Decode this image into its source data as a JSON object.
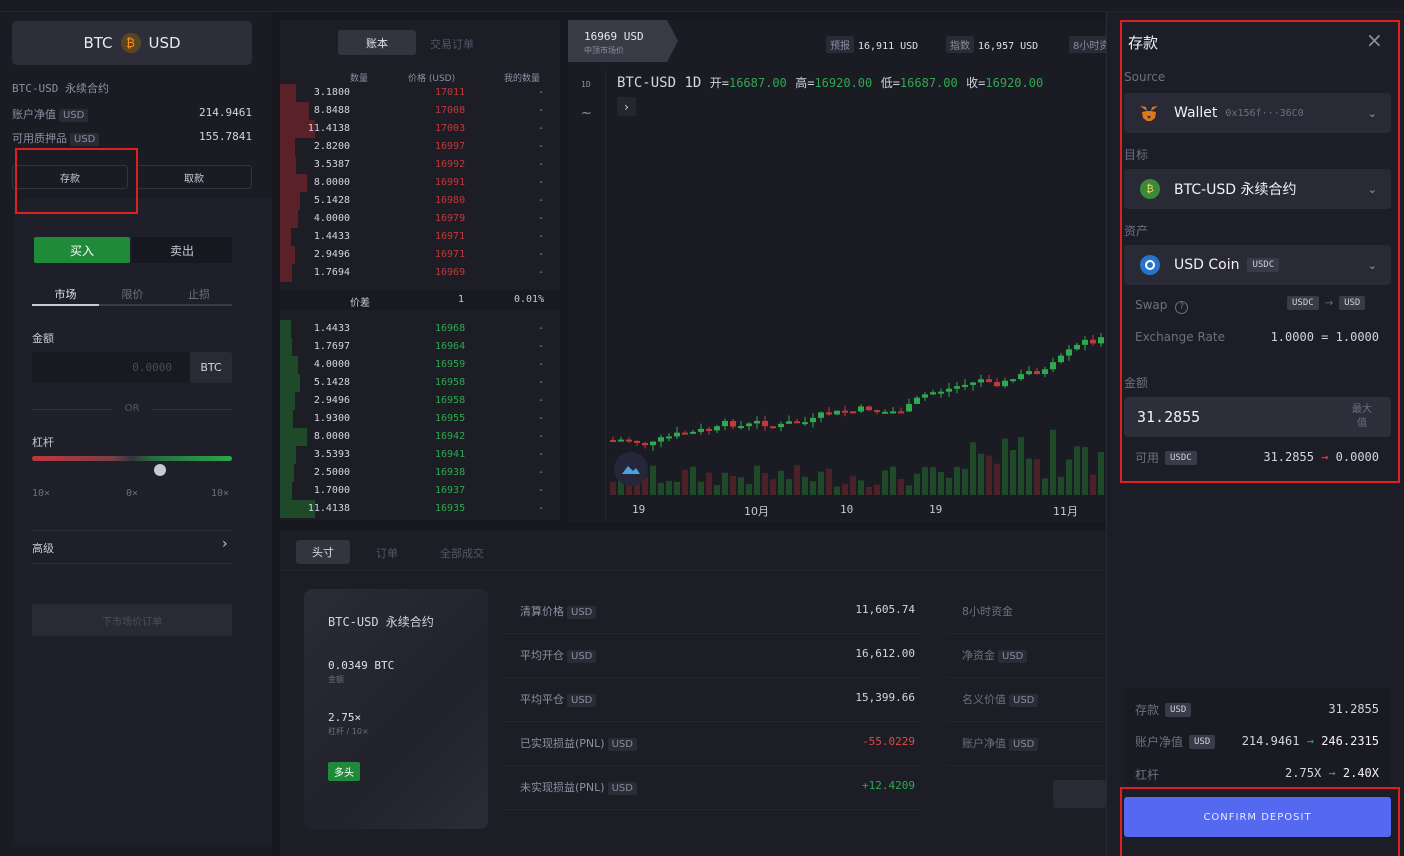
{
  "colors": {
    "accent": "#5468f0",
    "buy": "#1f8a3a",
    "up": "#2fa84f",
    "down": "#c0393b",
    "highlight": "#e02020"
  },
  "left": {
    "pair_base": "BTC",
    "pair_quote": "USD",
    "market_name": "BTC-USD 永续合约",
    "equity_label": "账户净值",
    "equity_unit": "USD",
    "equity_value": "214.9461",
    "collateral_label": "可用质押品",
    "collateral_unit": "USD",
    "collateral_value": "155.7841",
    "deposit_btn": "存款",
    "withdraw_btn": "取款",
    "buy_tab": "买入",
    "sell_tab": "卖出",
    "order_types": [
      "市场",
      "限价",
      "止损"
    ],
    "amount_label": "金额",
    "amount_placeholder": "0.0000",
    "amount_unit": "BTC",
    "or_label": "OR",
    "leverage_label": "杠杆",
    "lev_left": "10×",
    "lev_mid": "0×",
    "lev_right": "10×",
    "leverage_level": 0.64,
    "advanced_label": "高级",
    "advanced_chevron": "›",
    "submit_btn": "下市场价订单"
  },
  "book": {
    "tab_account": "账本",
    "tab_trades": "交易订单",
    "col_size": "数量",
    "col_price": "价格 (USD)",
    "col_mine": "我的数量",
    "asks": [
      [
        "3.1800",
        "17011",
        "-"
      ],
      [
        "8.8488",
        "17008",
        "-"
      ],
      [
        "11.4138",
        "17003",
        "-"
      ],
      [
        "2.8200",
        "16997",
        "-"
      ],
      [
        "3.5387",
        "16992",
        "-"
      ],
      [
        "8.0000",
        "16991",
        "-"
      ],
      [
        "5.1428",
        "16980",
        "-"
      ],
      [
        "4.0000",
        "16979",
        "-"
      ],
      [
        "1.4433",
        "16971",
        "-"
      ],
      [
        "2.9496",
        "16971",
        "-"
      ],
      [
        "1.7694",
        "16969",
        "-"
      ]
    ],
    "spread_label": "价差",
    "spread_value": "1",
    "spread_pct": "0.01%",
    "bids": [
      [
        "1.4433",
        "16968",
        "-"
      ],
      [
        "1.7697",
        "16964",
        "-"
      ],
      [
        "4.0000",
        "16959",
        "-"
      ],
      [
        "5.1428",
        "16958",
        "-"
      ],
      [
        "2.9496",
        "16958",
        "-"
      ],
      [
        "1.9300",
        "16955",
        "-"
      ],
      [
        "8.0000",
        "16942",
        "-"
      ],
      [
        "3.5393",
        "16941",
        "-"
      ],
      [
        "2.5000",
        "16938",
        "-"
      ],
      [
        "1.7000",
        "16937",
        "-"
      ],
      [
        "11.4138",
        "16935",
        "-"
      ]
    ]
  },
  "ticker": {
    "price": "16969 USD",
    "price_sub": "中顶市场价",
    "oracle_label": "预报",
    "oracle_value": "16,911 USD",
    "index_label": "指数",
    "index_value": "16,957 USD",
    "funding_label": "8小时资"
  },
  "chart": {
    "symbol": "BTC-USD",
    "interval": "1D",
    "interval_btn": "1D",
    "tool_icon": "~",
    "expand_icon": "›",
    "open_label": "开=",
    "open": "16687.00",
    "high_label": "高=",
    "high": "16920.00",
    "low_label": "低=",
    "low": "16687.00",
    "close_label": "收=",
    "close": "16920.00",
    "xticks": [
      "19",
      "10月",
      "10",
      "19",
      "11月"
    ]
  },
  "positions": {
    "tabs": [
      "头寸",
      "订单",
      "全部成交"
    ],
    "card_title": "BTC-USD 永续合约",
    "card_size": "0.0349 BTC",
    "card_size_sub": "金额",
    "card_lev": "2.75×",
    "card_lev_sub": "杠杆 / 10×",
    "card_side": "多头",
    "rows": [
      {
        "label": "清算价格",
        "unit": "USD",
        "value": "11,605.74"
      },
      {
        "label": "平均开仓",
        "unit": "USD",
        "value": "16,612.00"
      },
      {
        "label": "平均平仓",
        "unit": "USD",
        "value": "15,399.66"
      },
      {
        "label": "已实现损益(PNL)",
        "unit": "USD",
        "value": "-55.0229"
      },
      {
        "label": "未实现损益(PNL)",
        "unit": "USD",
        "value": "+12.4209"
      }
    ],
    "right_rows": [
      {
        "label": "8小时资金",
        "unit": ""
      },
      {
        "label": "净资金",
        "unit": "USD"
      },
      {
        "label": "名义价值",
        "unit": "USD"
      },
      {
        "label": "账户净值",
        "unit": "USD"
      }
    ]
  },
  "modal": {
    "title": "存款",
    "close_icon": "×",
    "source_label": "Source",
    "wallet_name": "Wallet",
    "wallet_addr": "0x156f···36C0",
    "target_label": "目标",
    "target_value": "BTC-USD 永续合约",
    "target_coin": "₿",
    "asset_label": "资产",
    "asset_value": "USD Coin",
    "asset_tag": "USDC",
    "swap_label": "Swap",
    "swap_help": "?",
    "swap_from": "USDC",
    "swap_arrow": "→",
    "swap_to": "USD",
    "rate_label": "Exchange Rate",
    "rate_from": "1.0000",
    "rate_eq": "=",
    "rate_to": "1.0000",
    "amount_label": "金额",
    "amount_value": "31.2855",
    "max_label": "最大值",
    "avail_label": "可用",
    "avail_tag": "USDC",
    "avail_from": "31.2855",
    "avail_arrow": "→",
    "avail_to": "0.0000",
    "sum_deposit_label": "存款",
    "sum_deposit_unit": "USD",
    "sum_deposit_value": "31.2855",
    "sum_equity_label": "账户净值",
    "sum_equity_unit": "USD",
    "sum_equity_from": "214.9461",
    "sum_equity_arrow": "→",
    "sum_equity_to": "246.2315",
    "sum_lev_label": "杠杆",
    "sum_lev_from": "2.75X",
    "sum_lev_arrow": "→",
    "sum_lev_to": "2.40X",
    "confirm_btn": "CONFIRM DEPOSIT"
  }
}
